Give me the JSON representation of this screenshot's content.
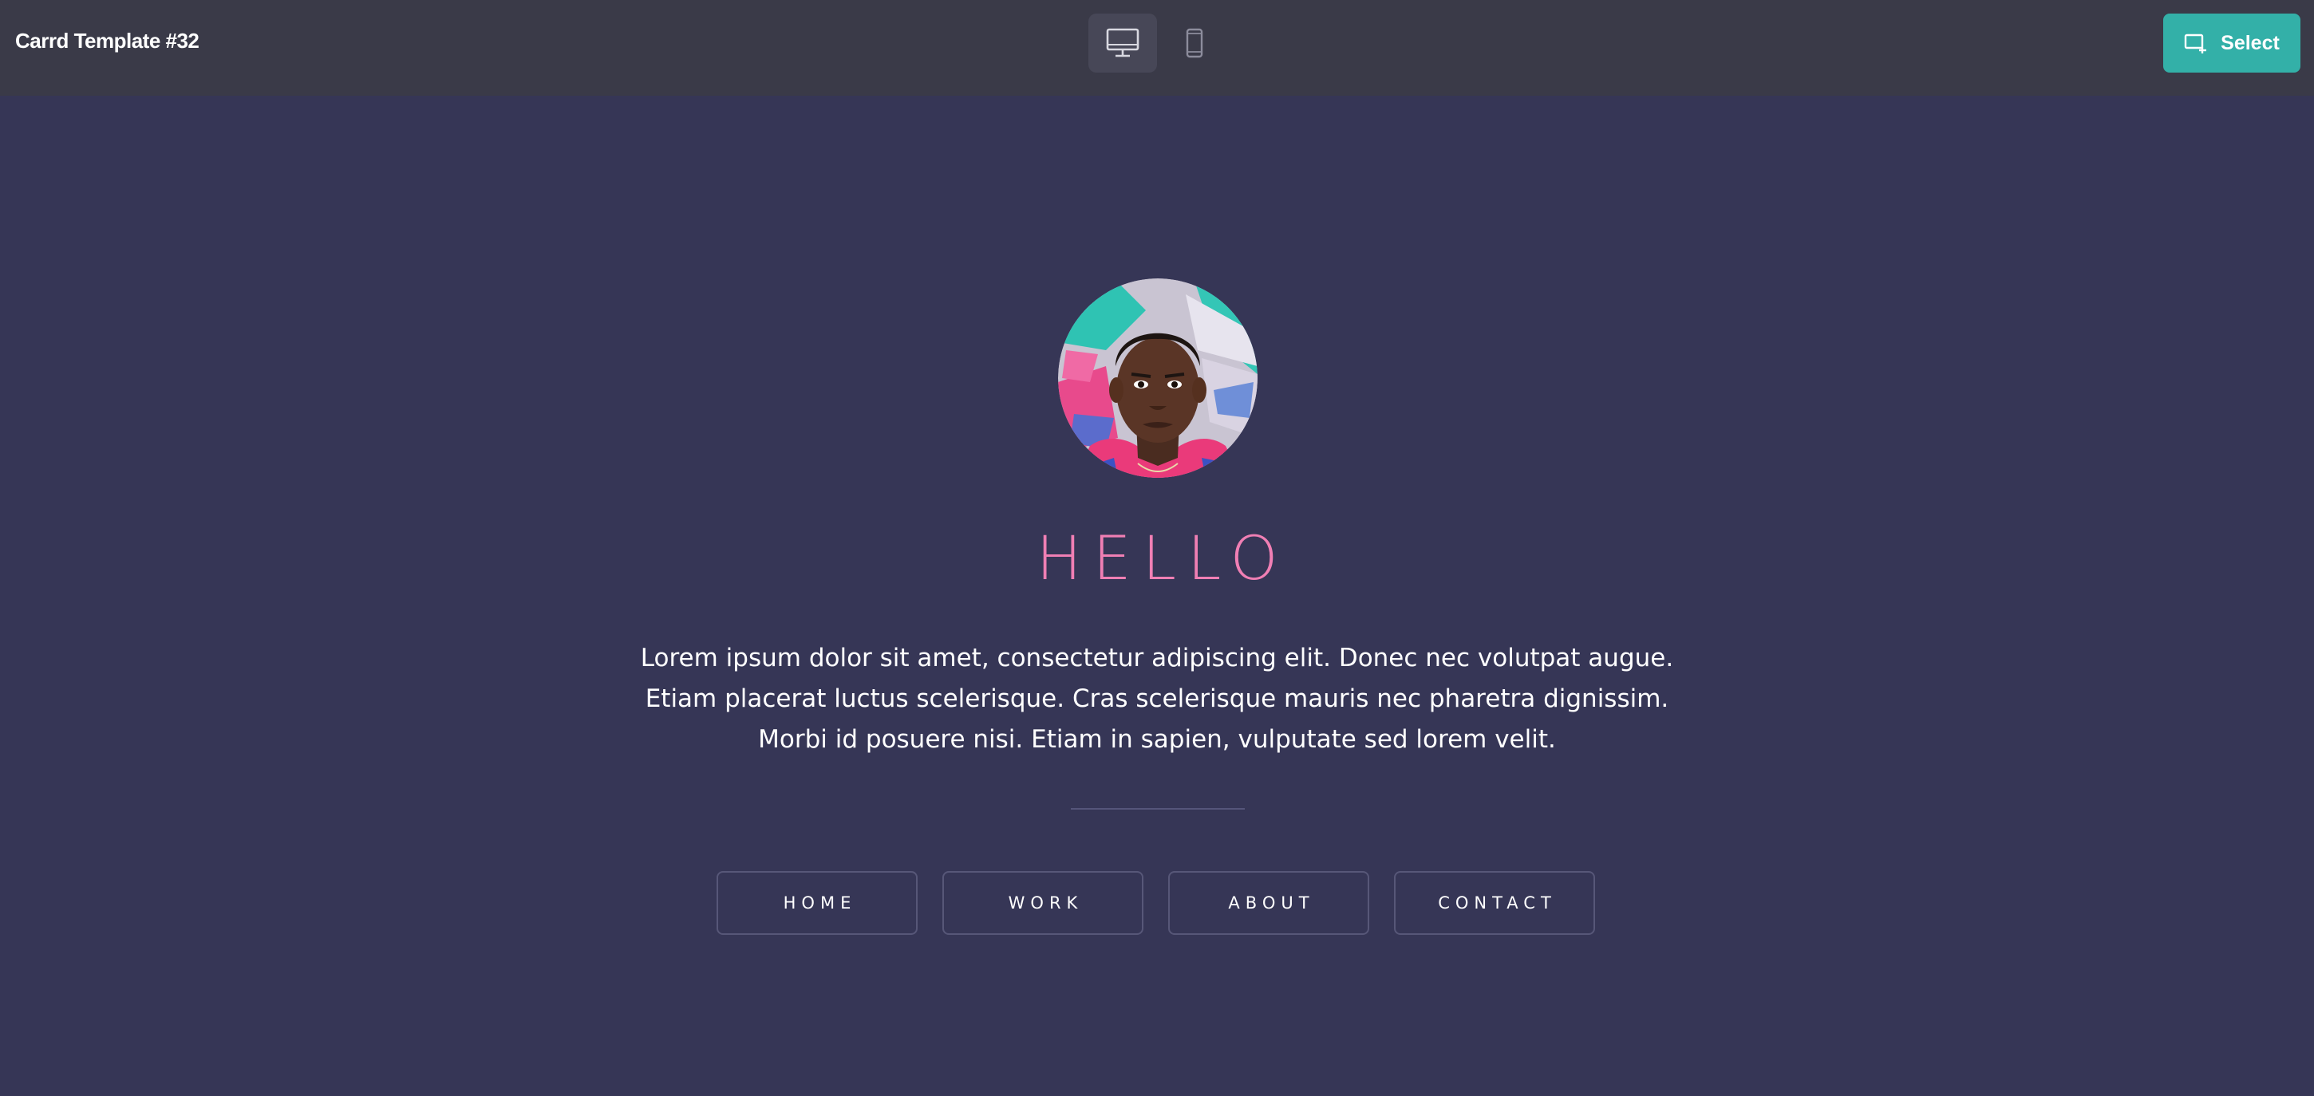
{
  "app": {
    "title": "Carrd Template #32"
  },
  "toolbar": {
    "desktop_icon": "desktop-monitor-icon",
    "mobile_icon": "mobile-phone-icon",
    "select_icon": "select-frame-icon",
    "select_label": "Select"
  },
  "page": {
    "avatar": "portrait-photo",
    "headline": "HELLO",
    "intro": "Lorem ipsum dolor sit amet, consectetur adipiscing elit. Donec nec volutpat augue. Etiam placerat luctus scelerisque. Cras scelerisque mauris nec pharetra dignissim. Morbi id posuere nisi. Etiam in sapien, vulputate sed lorem velit.",
    "nav": [
      "HOME",
      "WORK",
      "ABOUT",
      "CONTACT"
    ]
  },
  "colors": {
    "topbar": "#3a3a48",
    "background": "#363656",
    "accent": "#33b0a8",
    "headline": "#f07fb4"
  }
}
